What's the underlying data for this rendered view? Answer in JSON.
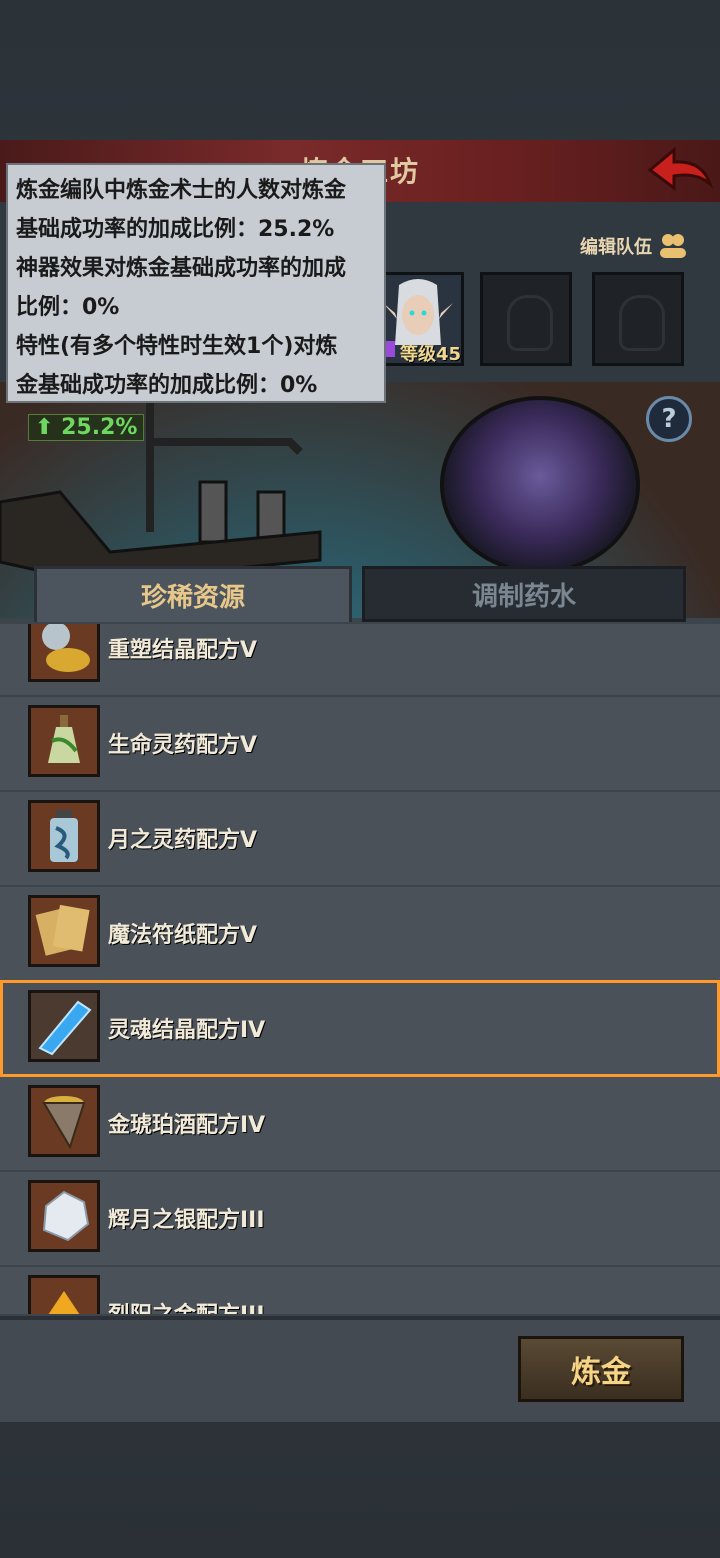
{
  "header": {
    "title": "炼金工坊"
  },
  "team": {
    "edit_label": "编辑队伍",
    "hero_level": "等级45"
  },
  "tooltip": {
    "lines": [
      "炼金编队中炼金术士的人数对炼金",
      "基础成功率的加成比例：25.2%",
      "神器效果对炼金基础成功率的加成",
      "比例：0%",
      "特性(有多个特性时生效1个)对炼",
      "金基础成功率的加成比例：0%"
    ]
  },
  "bonus": {
    "value": "25.2%"
  },
  "tabs": [
    {
      "label": "珍稀资源"
    },
    {
      "label": "调制药水"
    }
  ],
  "recipes": [
    {
      "label": "重塑结晶配方V",
      "icon": "gold-pile-icon"
    },
    {
      "label": "生命灵药配方V",
      "icon": "green-potion-icon"
    },
    {
      "label": "月之灵药配方V",
      "icon": "blue-bottle-icon"
    },
    {
      "label": "魔法符纸配方V",
      "icon": "parchment-icon"
    },
    {
      "label": "灵魂结晶配方IV",
      "icon": "blue-crystal-icon"
    },
    {
      "label": "金琥珀酒配方IV",
      "icon": "horn-cup-icon"
    },
    {
      "label": "辉月之银配方III",
      "icon": "silver-ore-icon"
    },
    {
      "label": "烈阳之金配方III",
      "icon": "gold-gem-icon"
    }
  ],
  "colors": {
    "accent": "#e8c88a",
    "selected_outline": "#ff9a2a",
    "bonus_green": "#6fd660"
  },
  "actions": {
    "alchemy_label": "炼金"
  }
}
